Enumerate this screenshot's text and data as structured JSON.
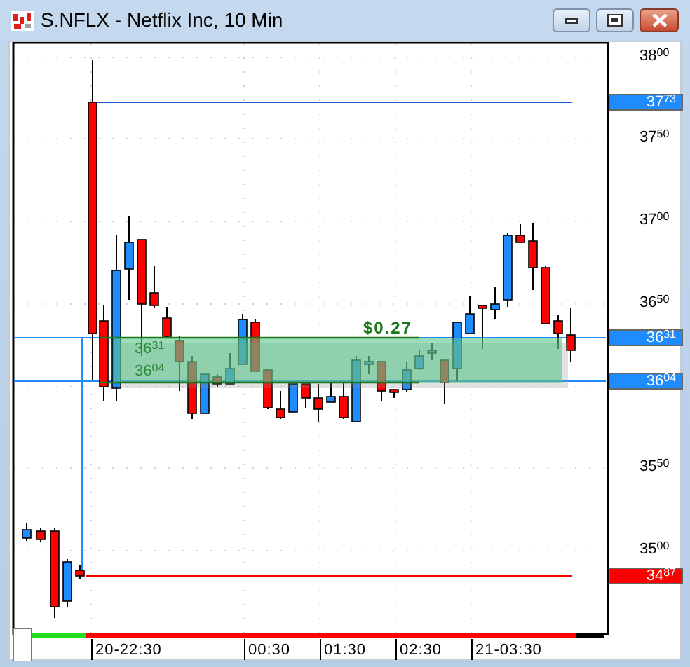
{
  "window": {
    "title": "S.NFLX - Netflix Inc, 10 Min"
  },
  "price_axis": {
    "ticks": [
      "38$^{00}$",
      "37$^{50}$",
      "37$^{00}$",
      "36$^{50}$",
      "35$^{50}$",
      "35$^{00}$"
    ]
  },
  "price_markers": [
    {
      "label": "37$^{73}$",
      "color": "#1e8cff"
    },
    {
      "label": "36$^{31}$",
      "color": "#1e8cff"
    },
    {
      "label": "36$^{04}$",
      "color": "#1e8cff"
    },
    {
      "label": "34$^{87}$",
      "color": "#ff0000"
    }
  ],
  "zone": {
    "difference": "$0.27",
    "upper_label": "36$^{31}$",
    "lower_label": "36$^{04}$"
  },
  "time_axis": {
    "labels": [
      "20-22:30",
      "00:30",
      "01:30",
      "02:30",
      "21-03:30"
    ]
  }
}
